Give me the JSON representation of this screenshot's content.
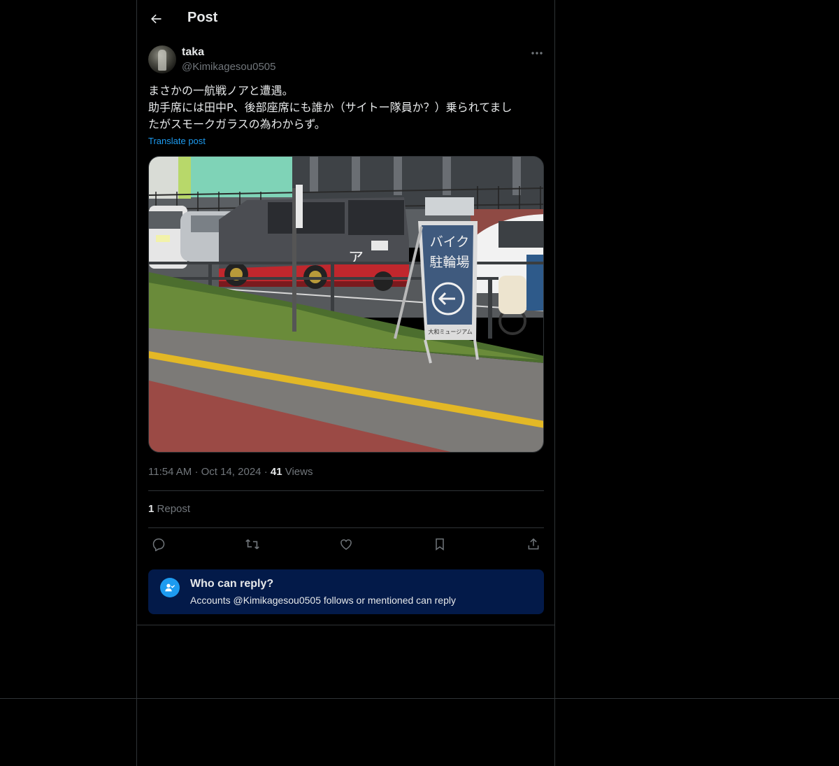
{
  "header": {
    "title": "Post"
  },
  "author": {
    "name": "taka",
    "handle": "@Kimikagesou0505"
  },
  "post": {
    "text": "まさかの一航戦ノアと遭遇。\n助手席には田中P、後部座席にも誰か（サイトー隊員か？）乗られてまし\nたがスモークガラスの為わからず。",
    "translate_label": "Translate post",
    "time": "11:54 AM",
    "date": "Oct 14, 2024",
    "views_count": "41",
    "views_label": "Views",
    "repost_count": "1",
    "repost_label": "Repost"
  },
  "photo": {
    "sign_line1": "バイク",
    "sign_line2": "駐輪場",
    "sign_footer": "大和ミュージアム",
    "van_letter": "ア"
  },
  "who_can_reply": {
    "title": "Who can reply?",
    "subtitle": "Accounts @Kimikagesou0505 follows or mentioned can reply"
  },
  "icons": {
    "back": "arrow-left-icon",
    "more": "more-horizontal-icon",
    "reply": "reply-icon",
    "repost": "repost-icon",
    "like": "like-icon",
    "bookmark": "bookmark-icon",
    "share": "share-icon",
    "who_can_reply": "person-check-icon"
  },
  "colors": {
    "background": "#000000",
    "accent": "#1d9bf0",
    "secondary_text": "#71767b",
    "border": "#2f3336",
    "notice_bg": "#031a49"
  }
}
